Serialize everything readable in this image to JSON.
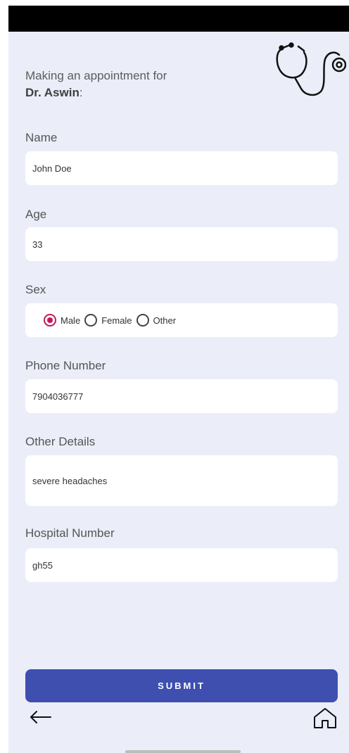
{
  "header": {
    "intro": "Making an appointment for",
    "doctor": "Dr. Aswin",
    "colon": ":"
  },
  "form": {
    "name_label": "Name",
    "name_value": "John Doe",
    "age_label": "Age",
    "age_value": "33",
    "sex_label": "Sex",
    "sex_options": [
      "Male",
      "Female",
      "Other"
    ],
    "sex_selected": "Male",
    "phone_label": "Phone Number",
    "phone_value": "7904036777",
    "details_label": "Other Details",
    "details_value": "severe headaches",
    "hospital_label": "Hospital Number",
    "hospital_value": "gh55"
  },
  "submit_label": "SUBMIT",
  "icons": {
    "stethoscope": "stethoscope-icon",
    "back": "back-arrow-icon",
    "home": "home-icon"
  },
  "colors": {
    "background": "#ebeef8",
    "accent": "#3f4fb0",
    "radio_checked": "#c2185b"
  }
}
